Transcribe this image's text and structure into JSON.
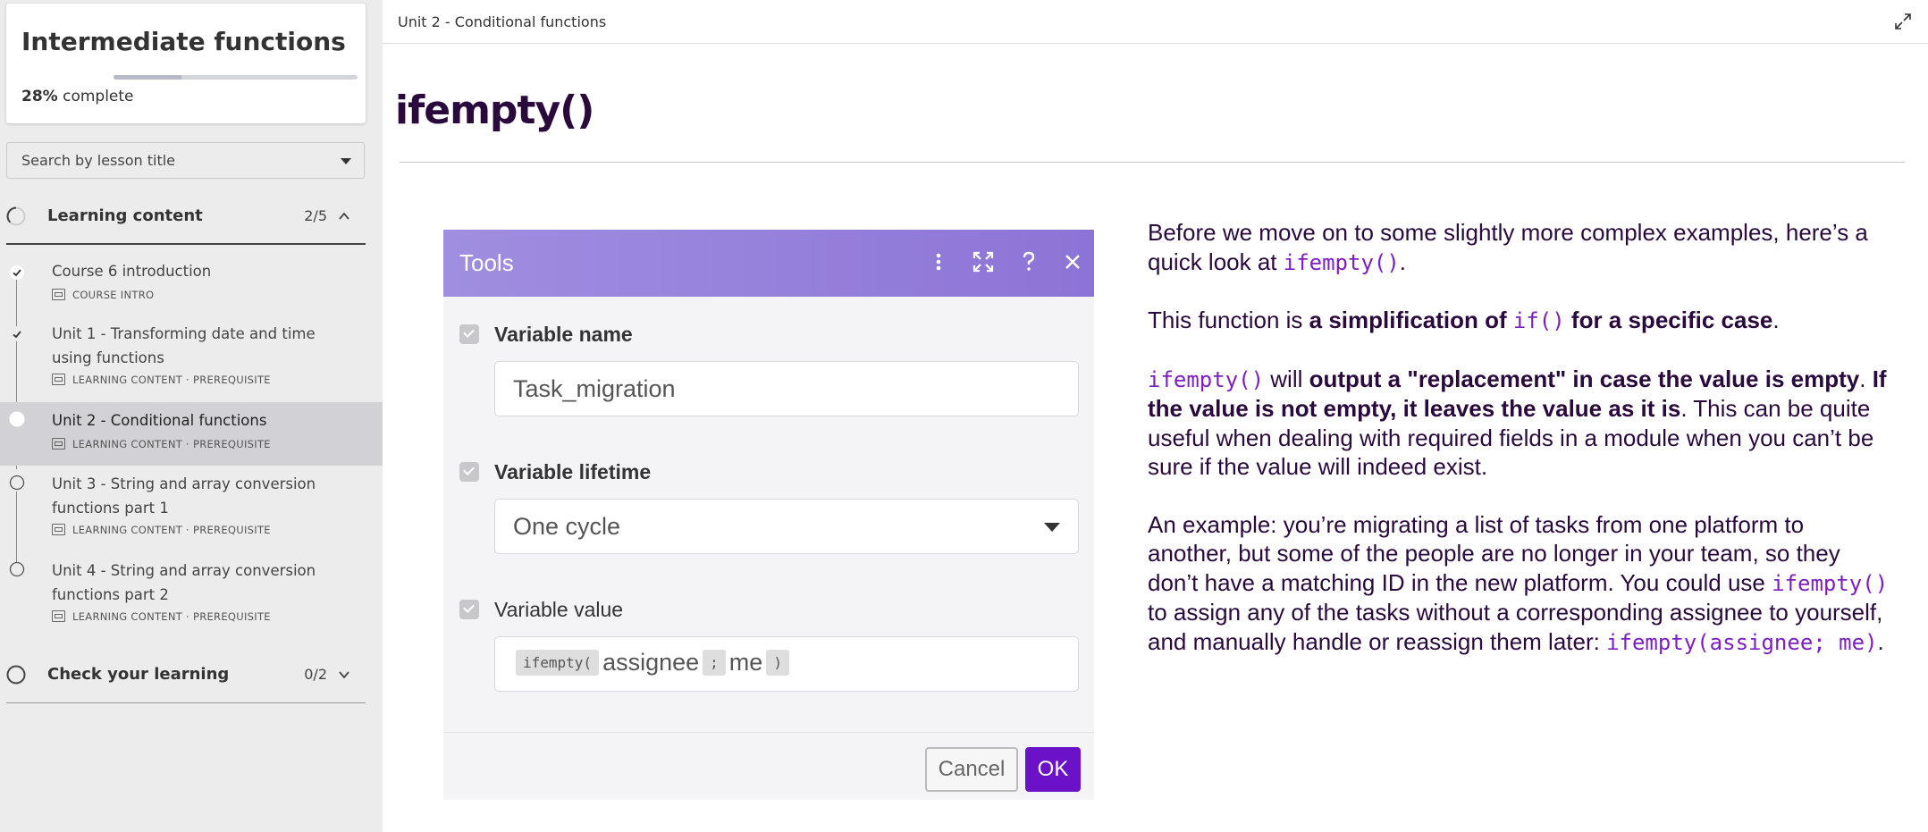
{
  "course": {
    "title": "Intermediate functions",
    "progress_percent": "28%",
    "progress_fraction": 0.28,
    "progress_suffix": " complete"
  },
  "search": {
    "placeholder": "Search by lesson title"
  },
  "sections": [
    {
      "title": "Learning content",
      "count": "2/5",
      "expanded": true,
      "lessons": [
        {
          "title": "Course 6 introduction",
          "meta": "COURSE INTRO",
          "status": "completed",
          "active": false
        },
        {
          "title": "Unit 1 - Transforming date and time using functions",
          "meta": "LEARNING CONTENT · PREREQUISITE",
          "status": "completed",
          "active": false
        },
        {
          "title": "Unit 2 - Conditional functions",
          "meta": "LEARNING CONTENT · PREREQUISITE",
          "status": "in-progress",
          "active": true
        },
        {
          "title": "Unit 3 - String and array conversion functions part 1",
          "meta": "LEARNING CONTENT · PREREQUISITE",
          "status": "not-started",
          "active": false
        },
        {
          "title": "Unit 4 - String and array conversion functions part 2",
          "meta": "LEARNING CONTENT · PREREQUISITE",
          "status": "not-started",
          "active": false
        }
      ]
    },
    {
      "title": "Check your learning",
      "count": "0/2",
      "expanded": false
    }
  ],
  "main": {
    "breadcrumb": "Unit 2 - Conditional functions",
    "lesson_title": "ifempty()"
  },
  "dialog": {
    "title": "Tools",
    "fields": [
      {
        "label": "Variable name",
        "value": "Task_migration"
      },
      {
        "label": "Variable lifetime",
        "value": "One cycle"
      },
      {
        "label": "Variable value",
        "expr_fn": "ifempty(",
        "expr_arg1": "assignee",
        "expr_sep": ";",
        "expr_arg2": "me",
        "expr_close": ")"
      }
    ],
    "cancel_label": "Cancel",
    "ok_label": "OK"
  },
  "article": {
    "p1_text": "Before we move on to some slightly more complex examples, here’s a quick look at ",
    "p1_code": "ifempty()",
    "p1_end": ".",
    "p2_text": "This function is ",
    "p2_bold1": "a simplification of ",
    "p2_code": "if()",
    "p2_bold2": " for a specific case",
    "p2_end": ".",
    "p3_code": "ifempty()",
    "p3_text1": " will ",
    "p3_bold1": "output a \"replacement\"  in case the value is empty",
    "p3_text2": ". ",
    "p3_bold2": "If the value is not empty, it leaves the value as it is",
    "p3_text3": ". This can be quite useful when dealing with required fields in a module when you can’t be sure if the value will indeed exist.",
    "p4_text1": "An example: you’re migrating a list of tasks from one platform to another, but some of the people are no longer in your team, so they don’t have a matching ID in the new platform. You could use ",
    "p4_code1": "ifempty()",
    "p4_text2": " to assign any of the tasks without a corresponding assignee to yourself, and manually handle or reassign them later: ",
    "p4_code2": "ifempty(assignee; me)",
    "p4_end": "."
  },
  "colors": {
    "accent_purple": "#6b12c9",
    "title_dark": "#2a0a3d",
    "code_purple": "#7b1fc4",
    "dialog_header": "#9a86de"
  }
}
